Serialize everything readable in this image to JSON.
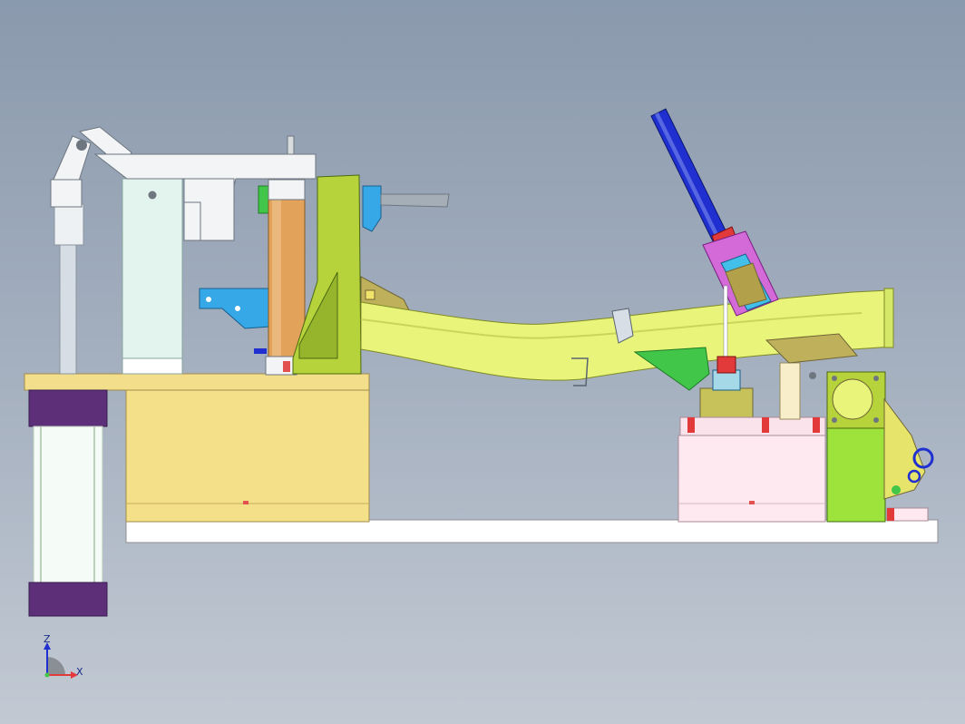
{
  "viewport": {
    "background_top": "#8a99ad",
    "background_bottom": "#c2c9d3"
  },
  "axes": {
    "z_label": "Z",
    "x_label": "X"
  },
  "colors": {
    "fixture_base": "#f5e08a",
    "base_plate": "#ffffff",
    "tube_part": "#e8f57a",
    "clamp_cylinder": "#e2a25a",
    "support_block": "#b6d33b",
    "air_cylinder_rod": "#1f2fd0",
    "cylinder_end_caps": "#5c2f78",
    "toggle_clamp_arm": "#f2f4f6",
    "stand_column": "#e3f4ef",
    "right_support_block": "#ffe9f0",
    "right_clamp_body": "#9ee23c"
  }
}
